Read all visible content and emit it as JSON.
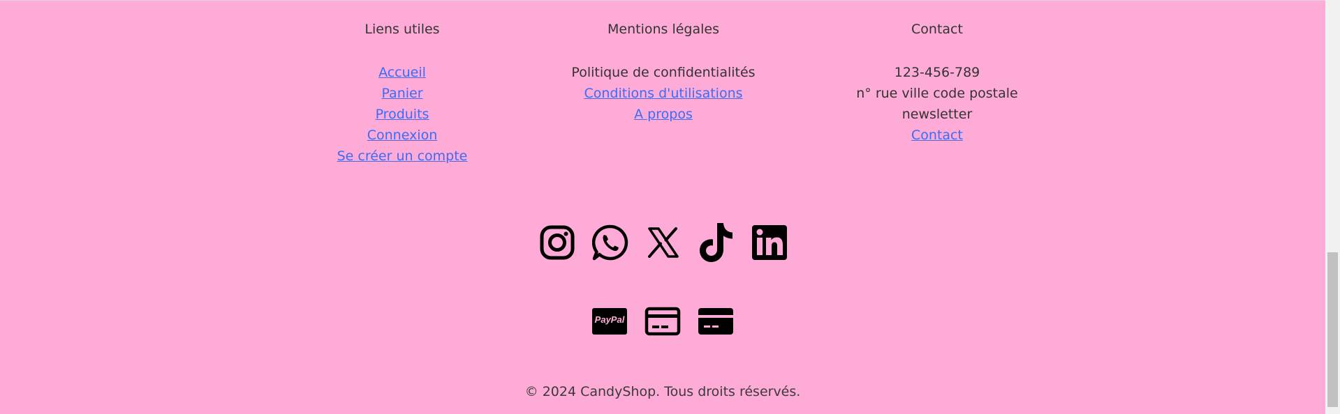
{
  "footer": {
    "columns": [
      {
        "title": "Liens utiles",
        "items": [
          {
            "label": "Accueil",
            "link": true
          },
          {
            "label": "Panier",
            "link": true
          },
          {
            "label": "Produits",
            "link": true
          },
          {
            "label": "Connexion",
            "link": true
          },
          {
            "label": "Se créer un compte",
            "link": true
          }
        ]
      },
      {
        "title": "Mentions légales",
        "items": [
          {
            "label": "Politique de confidentialités",
            "link": false
          },
          {
            "label": "Conditions d'utilisations",
            "link": true
          },
          {
            "label": "A propos",
            "link": true
          }
        ]
      },
      {
        "title": "Contact",
        "items": [
          {
            "label": "123-456-789",
            "link": false
          },
          {
            "label": "n° rue ville code postale",
            "link": false
          },
          {
            "label": "newsletter",
            "link": false
          },
          {
            "label": "Contact",
            "link": true
          }
        ]
      }
    ],
    "social_icons": [
      "instagram-icon",
      "whatsapp-icon",
      "x-icon",
      "tiktok-icon",
      "linkedin-icon"
    ],
    "payment_icons": [
      "paypal-icon",
      "credit-card-icon",
      "card-icon"
    ],
    "paypal_text": "PayPal",
    "copyright": "© 2024 CandyShop. Tous droits réservés."
  },
  "colors": {
    "background": "#ffabd7",
    "link": "#3b6cf6",
    "text": "#333333",
    "icon": "#000000"
  }
}
